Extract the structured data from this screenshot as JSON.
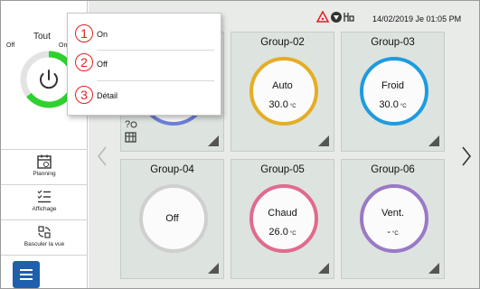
{
  "sidebar": {
    "all_label": "Tout",
    "off_label": "Off",
    "on_label": "On",
    "items": [
      {
        "label": "Planning",
        "icon": "calendar-icon"
      },
      {
        "label": "Affichage",
        "icon": "list-icon"
      },
      {
        "label": "Basculer la vue",
        "icon": "switch-view-icon"
      }
    ],
    "menu_icon": "hamburger-menu-icon"
  },
  "header": {
    "datetime": "14/02/2019 Je 01:05 PM",
    "status_icons": [
      "warning-icon",
      "shield-icon",
      "network-icon"
    ]
  },
  "popup": {
    "items": [
      {
        "num": "①",
        "label": "On"
      },
      {
        "num": "②",
        "label": "Off"
      },
      {
        "num": "③",
        "label": "Détail"
      }
    ]
  },
  "groups": [
    {
      "name": "Group-02",
      "mode": "Auto",
      "temp": "30.0",
      "unit": "°C",
      "color": "#e6ad24"
    },
    {
      "name": "Group-03",
      "mode": "Froid",
      "temp": "30.0",
      "unit": "°C",
      "color": "#1e9be0"
    },
    {
      "name": "Group-04",
      "mode": "Off",
      "temp": "",
      "unit": "",
      "color": "#cfcfcf"
    },
    {
      "name": "Group-05",
      "mode": "Chaud",
      "temp": "26.0",
      "unit": "°C",
      "color": "#e06b8d"
    },
    {
      "name": "Group-06",
      "mode": "Vent.",
      "temp": "-",
      "unit": "°C",
      "color": "#9a79c6"
    }
  ],
  "colors": {
    "power_ring": "#2fd12f",
    "accent_blue": "#1f5fae",
    "alert_red": "#e02020"
  }
}
